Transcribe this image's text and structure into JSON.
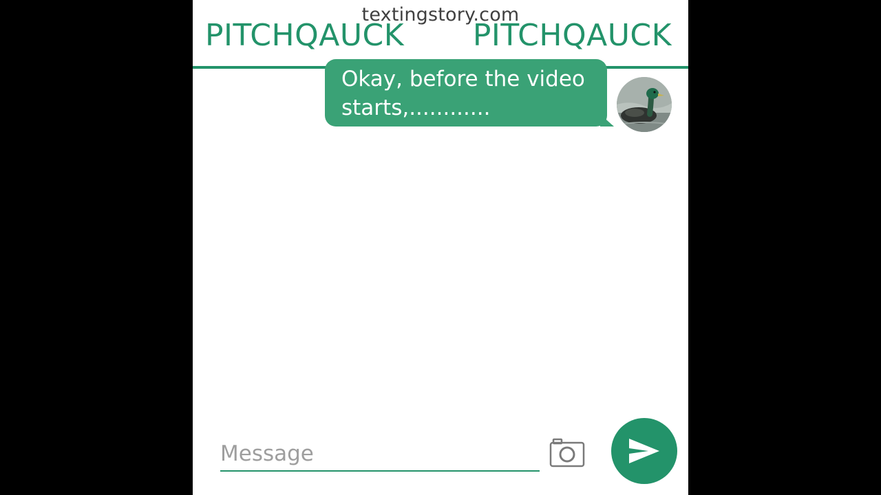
{
  "watermark": "textingstory.com",
  "header": {
    "contact_name_left": "PITCHQAUCK",
    "contact_name_right": "PITCHQAUCK"
  },
  "messages": [
    {
      "sender": "self",
      "text": "Okay, before the video starts,............",
      "avatar_icon": "duck-avatar"
    }
  ],
  "composer": {
    "placeholder": "Message",
    "camera_icon": "camera-icon",
    "send_icon": "send-icon"
  },
  "colors": {
    "accent": "#23936a",
    "bubble": "#3aa276",
    "background": "#ffffff",
    "outer": "#000000"
  }
}
